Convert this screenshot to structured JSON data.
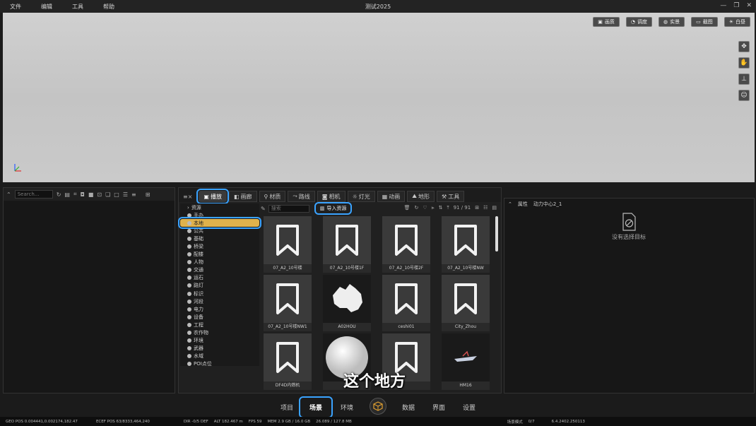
{
  "menu": {
    "items": [
      "文件",
      "编辑",
      "工具",
      "帮助"
    ],
    "window_title": "测试2025"
  },
  "viewport": {
    "toolbar": [
      "画质",
      "调度",
      "实景",
      "截图",
      "白昼"
    ],
    "side_icons": [
      "move-icon",
      "hand-icon",
      "axis-icon",
      "person-icon"
    ]
  },
  "left_panel": {
    "search_placeholder": "Search..."
  },
  "center_panel": {
    "tabs": [
      "播放",
      "画廊",
      "材质",
      "路线",
      "相机",
      "灯光",
      "动画",
      "地形",
      "工具"
    ],
    "grid_search_placeholder": "搜索",
    "import_label": "导入资源",
    "count": "91 / 91",
    "categories": [
      "资源",
      "手办",
      "本地",
      "公共",
      "基础",
      "桥梁",
      "配楼",
      "人物",
      "交通",
      "运石",
      "路灯",
      "标识",
      "河段",
      "电力",
      "设备",
      "工程",
      "农作物",
      "环境",
      "武器",
      "水域",
      "POI点位"
    ],
    "assets": [
      {
        "label": "07_A2_10号楼",
        "kind": "bookmark"
      },
      {
        "label": "07_A2_10号楼1F",
        "kind": "bookmark"
      },
      {
        "label": "07_A2_10号楼2F",
        "kind": "bookmark"
      },
      {
        "label": "07_A2_10号楼NW",
        "kind": "bookmark"
      },
      {
        "label": "07_A2_10号楼NW1",
        "kind": "bookmark"
      },
      {
        "label": "A02HOU",
        "kind": "australia"
      },
      {
        "label": "ceshi01",
        "kind": "bookmark"
      },
      {
        "label": "City_Zhou",
        "kind": "bookmark"
      },
      {
        "label": "DF4D内燃机",
        "kind": "bookmark"
      },
      {
        "label": "Ea",
        "kind": "sphere"
      },
      {
        "label": "",
        "kind": "bookmark"
      },
      {
        "label": "HM16",
        "kind": "ship"
      }
    ]
  },
  "right_panel": {
    "header_title": "属性",
    "header_target": "动力中心2_1",
    "empty_text": "没有选择目标"
  },
  "subtitle": "这个地方",
  "bottom_nav": {
    "items": [
      "项目",
      "场景",
      "环境",
      "数据",
      "界面",
      "设置"
    ]
  },
  "statusbar": {
    "geo": "GEO POS 0.004441,0.002174,182.47",
    "ecef": "ECEF POS 63/8333,464,240",
    "dir": "DIR -0/5 DEF",
    "alt": "ALT 182.467 m",
    "fps": "FPS 59",
    "mem": "MEM 2.9 GB / 16.0 GB",
    "vram": "26.089 / 127.8 MB",
    "mode": "场景模式",
    "count": "0/7",
    "version": "6.4.2402.250113"
  },
  "colors": {
    "highlight": "#3aa3ff",
    "selected_category": "#e0b24c"
  }
}
